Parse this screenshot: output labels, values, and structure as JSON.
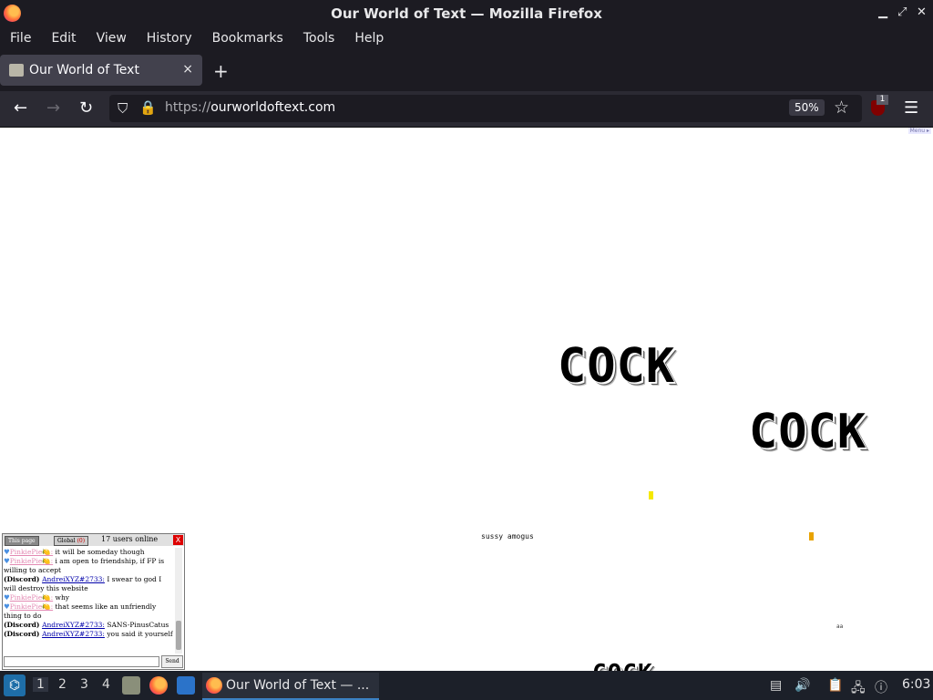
{
  "window": {
    "title": "Our World of Text — Mozilla Firefox"
  },
  "menubar": [
    "File",
    "Edit",
    "View",
    "History",
    "Bookmarks",
    "Tools",
    "Help"
  ],
  "tab": {
    "title": "Our World of Text",
    "close": "×"
  },
  "newtab": "+",
  "nav": {
    "url_proto": "https://",
    "url_host": "ourworldoftext.com",
    "zoom": "50%",
    "ublock_count": "1"
  },
  "page": {
    "menu_tag": "Menu ▸",
    "art_words": [
      "COCK",
      "COCK",
      "COCK"
    ],
    "small_texts": [
      "sussy amogus",
      "aa"
    ],
    "pixel_colors": [
      "#f5e800",
      "#e8a300"
    ]
  },
  "chat": {
    "tab_page": "This page",
    "tab_global": "Global",
    "global_count": "(0)",
    "online": "17 users online",
    "close": "X",
    "send": "Send",
    "messages": [
      {
        "tag": "",
        "nick": "PinkiePie🍋:",
        "nick_type": "pinkie",
        "text": " it will be someday though"
      },
      {
        "tag": "",
        "nick": "PinkiePie🍋:",
        "nick_type": "pinkie",
        "text": " i am open to friendship, if FP is willing to accept"
      },
      {
        "tag": "(Discord) ",
        "nick": "AndreiXYZ#2733:",
        "nick_type": "discord",
        "text": " I swear to god I will destroy this website"
      },
      {
        "tag": "",
        "nick": "PinkiePie🍋:",
        "nick_type": "pinkie",
        "text": " why"
      },
      {
        "tag": "",
        "nick": "PinkiePie🍋:",
        "nick_type": "pinkie",
        "text": " that seems like an unfriendly thing to do"
      },
      {
        "tag": "(Discord) ",
        "nick": "AndreiXYZ#2733:",
        "nick_type": "discord",
        "text": " SANS-PinusCatus"
      },
      {
        "tag": "(Discord) ",
        "nick": "AndreiXYZ#2733:",
        "nick_type": "discord",
        "text": " you said it yourself"
      }
    ]
  },
  "taskbar": {
    "workspaces": [
      "1",
      "2",
      "3",
      "4"
    ],
    "window_label": "Our World of Text — ...",
    "clock": "6:03"
  }
}
